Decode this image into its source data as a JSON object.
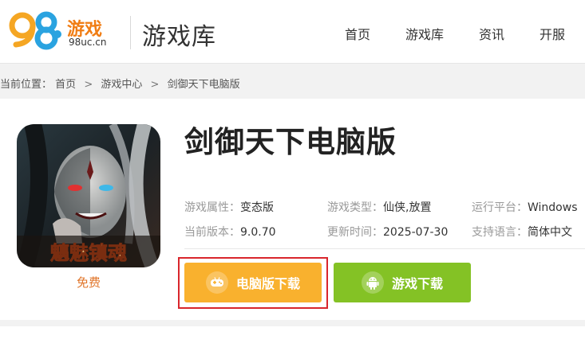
{
  "header": {
    "logo_text": "98游戏",
    "logo_domain": "98uc.cn",
    "title": "游戏库",
    "nav": [
      {
        "label": "首页"
      },
      {
        "label": "游戏库"
      },
      {
        "label": "资讯"
      },
      {
        "label": "开服"
      }
    ]
  },
  "breadcrumb": {
    "prefix": "当前位置：",
    "items": [
      "首页",
      "游戏中心",
      "剑御天下电脑版"
    ],
    "separator": ">"
  },
  "game": {
    "title": "剑御天下电脑版",
    "cover_caption": "魑魅镇魂",
    "price": "免费",
    "attributes": [
      {
        "key": "游戏属性：",
        "value": "变态版"
      },
      {
        "key": "游戏类型：",
        "value": "仙侠,放置"
      },
      {
        "key": "运行平台：",
        "value": "Windows"
      },
      {
        "key": "当前版本：",
        "value": "9.0.70"
      },
      {
        "key": "更新时间：",
        "value": "2025-07-30"
      },
      {
        "key": "支持语言：",
        "value": "简体中文"
      }
    ],
    "buttons": {
      "pc_download": "电脑版下载",
      "game_download": "游戏下载"
    }
  },
  "colors": {
    "pc_button": "#f9b12e",
    "game_button": "#84c225",
    "price": "#e0752a",
    "highlight": "#d9262c"
  },
  "icons": {
    "pc_button_icon": "gamepad-icon",
    "game_button_icon": "android-icon"
  }
}
